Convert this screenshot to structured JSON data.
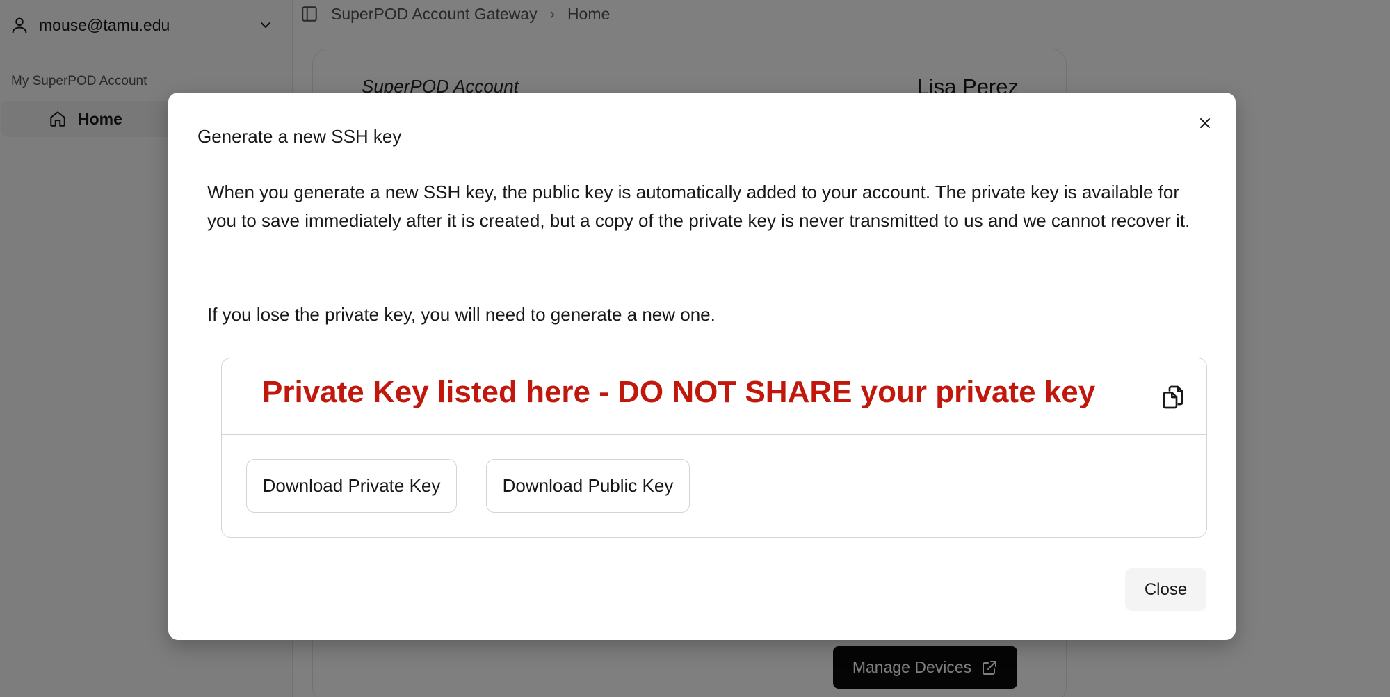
{
  "sidebar": {
    "user_email": "mouse@tamu.edu",
    "group_label": "My SuperPOD Account",
    "items": [
      {
        "label": "Home",
        "icon": "home-icon",
        "active": true
      }
    ]
  },
  "breadcrumb": {
    "root": "SuperPOD Account Gateway",
    "current": "Home"
  },
  "account_card": {
    "label": "SuperPOD Account",
    "name": "Lisa Perez",
    "manage_devices_label": "Manage Devices"
  },
  "dialog": {
    "title": "Generate a new SSH key",
    "paragraph1": "When you generate a new SSH key, the public key is automatically added to your account. The private key is available for you to save immediately after it is created, but a copy of the private key is never transmitted to us and we cannot recover it.",
    "paragraph2": "If you lose the private key, you will need to generate a new one.",
    "private_key_text": "Private Key listed here - DO NOT SHARE your private key",
    "download_private_label": "Download Private Key",
    "download_public_label": "Download Public Key",
    "close_label": "Close"
  },
  "colors": {
    "warning_red": "#c0180c",
    "primary_button": "#0a0a0a"
  }
}
